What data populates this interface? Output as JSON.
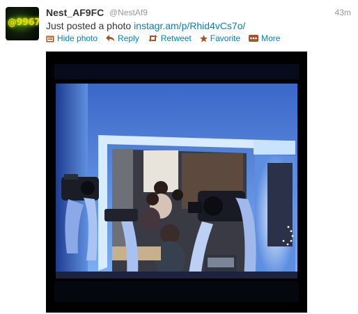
{
  "tweet": {
    "avatar_text": "@9967",
    "display_name": "Nest_AF9FC",
    "handle": "@NestAf9",
    "time": "43m",
    "text": "Just posted a photo ",
    "link": "instagr.am/p/Rhid4vCs7o/"
  },
  "actions": {
    "hide_photo": "Hide photo",
    "reply": "Reply",
    "retweet": "Retweet",
    "favorite": "Favorite",
    "more": "More"
  },
  "colors": {
    "link": "#0084b4",
    "text": "#333333",
    "muted": "#999999",
    "action_icon": "#a2552a"
  },
  "icons": [
    "photo-icon",
    "reply-icon",
    "retweet-icon",
    "star-icon",
    "more-icon"
  ]
}
